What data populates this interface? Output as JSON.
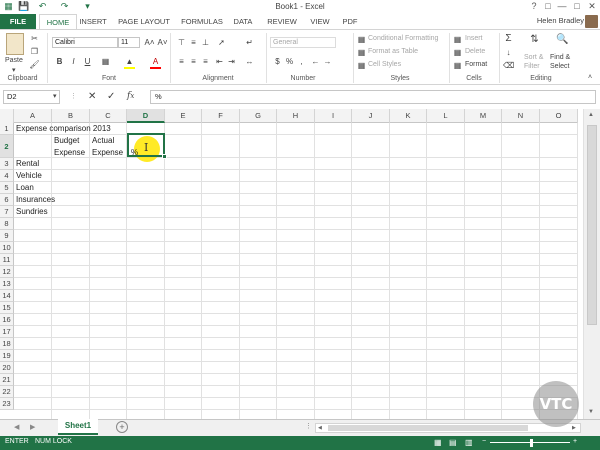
{
  "window": {
    "title": "Book1 - Excel",
    "user": "Helen Bradley"
  },
  "tabs": [
    "FILE",
    "HOME",
    "INSERT",
    "PAGE LAYOUT",
    "FORMULAS",
    "DATA",
    "REVIEW",
    "VIEW",
    "PDF"
  ],
  "ribbon": {
    "clipboard": {
      "paste": "Paste",
      "label": "Clipboard"
    },
    "font": {
      "name": "Calibri",
      "size": "11",
      "label": "Font"
    },
    "alignment": {
      "label": "Alignment"
    },
    "number": {
      "format": "General",
      "label": "Number"
    },
    "styles": {
      "conditional": "Conditional Formatting",
      "table": "Format as Table",
      "cell": "Cell Styles",
      "label": "Styles"
    },
    "cells": {
      "insert": "Insert",
      "delete": "Delete",
      "format": "Format",
      "label": "Cells"
    },
    "editing": {
      "sort": "Sort &",
      "filter": "Filter",
      "find": "Find &",
      "select": "Select",
      "label": "Editing"
    }
  },
  "formula_bar": {
    "name_box": "D2",
    "value": "%"
  },
  "columns": [
    "A",
    "B",
    "C",
    "D",
    "E",
    "F",
    "G",
    "H",
    "I",
    "J",
    "K",
    "L",
    "M",
    "N",
    "O"
  ],
  "rows": [
    "1",
    "2",
    "3",
    "4",
    "5",
    "6",
    "7",
    "8",
    "9",
    "10",
    "11",
    "12",
    "13",
    "14",
    "15",
    "16",
    "17",
    "18",
    "19",
    "20",
    "21",
    "22",
    "23"
  ],
  "cells": {
    "a1": "Expense comparison 2013",
    "b2a": "Budget",
    "b2b": "Expense",
    "c2a": "Actual",
    "c2b": "Expense",
    "d2": "%",
    "a3": "Rental",
    "a4": "Vehicle",
    "a5": "Loan",
    "a6": "Insurances",
    "a7": "Sundries"
  },
  "sheet_tab": "Sheet1",
  "status": {
    "mode": "ENTER",
    "numlock": "NUM LOCK"
  },
  "watermark": "VTC",
  "colors": {
    "accent": "#217346"
  }
}
